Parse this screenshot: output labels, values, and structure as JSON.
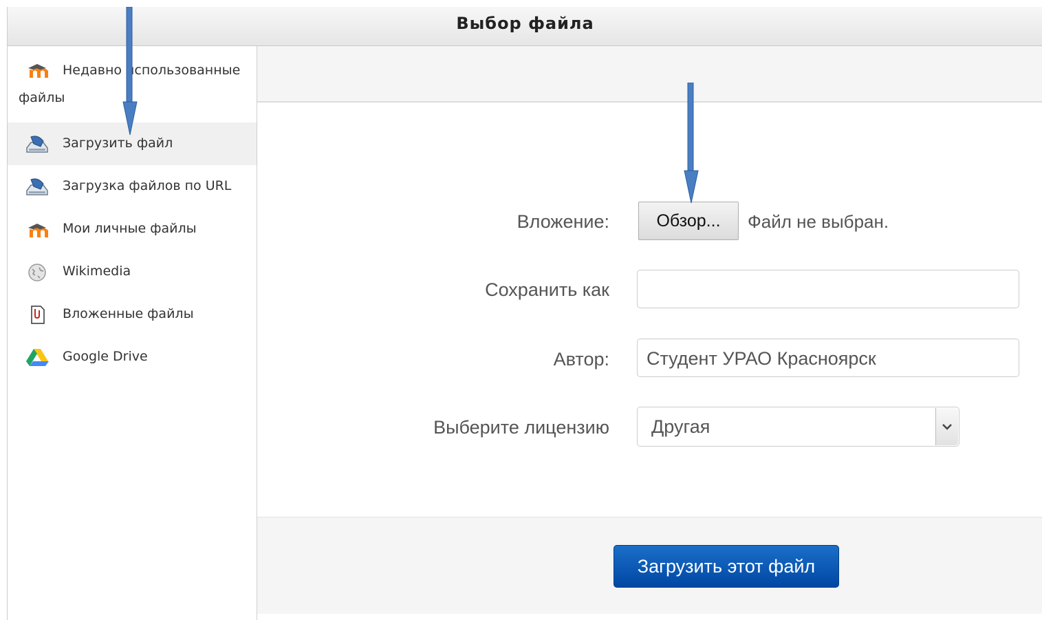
{
  "dialog": {
    "title": "Выбор файла"
  },
  "sidebar": {
    "items": [
      {
        "label": "Недавно использованные файлы",
        "icon": "moodle-icon",
        "active": false
      },
      {
        "label": "Загрузить файл",
        "icon": "upload-icon",
        "active": true
      },
      {
        "label": "Загрузка файлов по URL",
        "icon": "upload-icon",
        "active": false
      },
      {
        "label": "Мои личные файлы",
        "icon": "moodle-icon",
        "active": false
      },
      {
        "label": "Wikimedia",
        "icon": "wikimedia-icon",
        "active": false
      },
      {
        "label": "Вложенные файлы",
        "icon": "attachment-icon",
        "active": false
      },
      {
        "label": "Google Drive",
        "icon": "google-drive-icon",
        "active": false
      }
    ]
  },
  "form": {
    "attachment_label": "Вложение:",
    "browse_label": "Обзор...",
    "no_file_text": "Файл не выбран.",
    "save_as_label": "Сохранить как",
    "save_as_value": "",
    "author_label": "Автор:",
    "author_value": "Студент УРАО Красноярск",
    "license_label": "Выберите лицензию",
    "license_value": "Другая"
  },
  "footer": {
    "upload_label": "Загрузить этот файл"
  },
  "colors": {
    "accent": "#0a5bbf",
    "annotation_arrow": "#4a7ec2"
  }
}
